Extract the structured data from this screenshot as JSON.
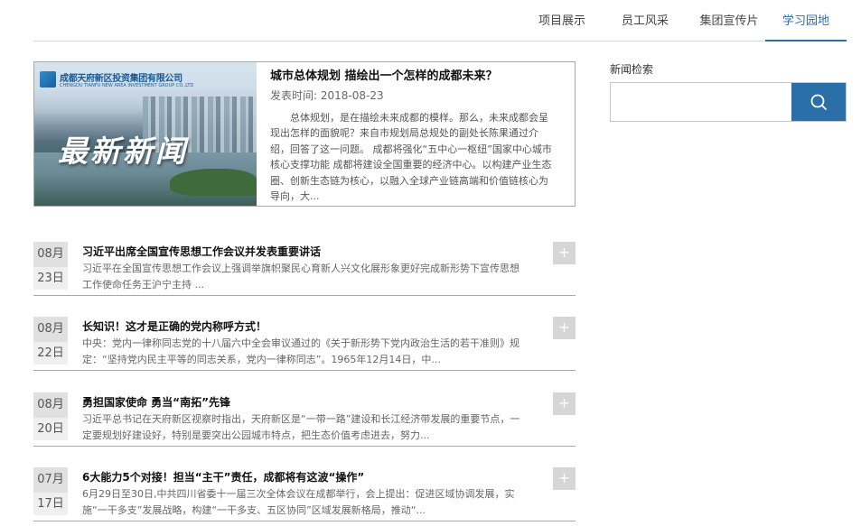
{
  "tabs": [
    {
      "label": "项目展示",
      "active": false
    },
    {
      "label": "员工风采",
      "active": false
    },
    {
      "label": "集团宣传片",
      "active": false
    },
    {
      "label": "学习园地",
      "active": true
    }
  ],
  "featured": {
    "image": {
      "logo_text": "成都天府新区投资集团有限公司",
      "logo_text_en": "CHENGDU TIANFU NEW AREA INVESTMENT GROUP CO.,LTD",
      "overlay_text": "最新新闻"
    },
    "title": "城市总体规划   描绘出一个怎样的成都未来？",
    "date": "发表时间: 2018-08-23",
    "summary": "总体规划，是在描绘未来成都的模样。那么，未来成都会呈现出怎样的面貌呢？来自市规划局总规处的副处长陈果通过介绍，回答了这一问题。     成都将强化“五中心一枢纽”国家中心城市核心支撑功能     成都将建设全国重要的经济中心。以构建产业生态圈、创新生态链为核心，以融入全球产业链高端和价值链核心为导向，大..."
  },
  "news": [
    {
      "month": "08月",
      "day": "23日",
      "title": "习近平出席全国宣传思想工作会议并发表重要讲话",
      "summary": "习近平在全国宣传思想工作会议上强调举旗帜聚民心育新人兴文化展形象更好完成新形势下宣传思想工作使命任务王沪宁主持                    ..."
    },
    {
      "month": "08月",
      "day": "22日",
      "title": "长知识！这才是正确的党内称呼方式！",
      "summary": "中央：党内一律称同志党的十八届六中全会审议通过的《关于新形势下党内政治生活的若干准则》规定：“坚持党内民主平等的同志关系，党内一律称同志”。1965年12月14日，中..."
    },
    {
      "month": "08月",
      "day": "20日",
      "title": "勇担国家使命 勇当“南拓”先锋",
      "summary": "习近平总书记在天府新区视察时指出，天府新区是“一带一路”建设和长江经济带发展的重要节点，一定要规划好建设好，特别是要突出公园城市特点，把生态价值考虑进去，努力..."
    },
    {
      "month": "07月",
      "day": "17日",
      "title": "6大能力5个对接！担当“主干”责任，成都将有这波“操作”",
      "summary": "6月29日至30日,中共四川省委十一届三次全体会议在成都举行，会上提出：促进区域协调发展，实施“一干多支”发展战略，构建“一干多支、五区协同”区域发展新格局，推动“..."
    }
  ],
  "plus_symbol": "+",
  "search": {
    "label": "新闻检索",
    "value": "",
    "placeholder": "",
    "button_icon": "search-icon"
  },
  "colors": {
    "accent": "#2a6fa8",
    "date_box": "#e0e0e0",
    "plus_button": "#d6d6d6"
  }
}
